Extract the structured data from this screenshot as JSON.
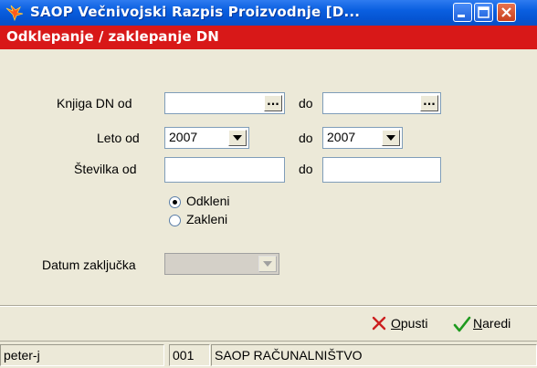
{
  "window": {
    "title": "SAOP   Večnivojski Razpis Proizvodnje [D...",
    "icon": "saop-bird-icon"
  },
  "form_title": "Odklepanje / zaklepanje DN",
  "form": {
    "knjiga_label": "Knjiga DN od",
    "knjiga_od_value": "",
    "do_label": "do",
    "knjiga_do_value": "",
    "ellipsis": "...",
    "leto_label": "Leto od",
    "leto_od_value": "2007",
    "leto_do_value": "2007",
    "stevilka_label": "Številka od",
    "stevilka_od_value": "",
    "stevilka_do_value": "",
    "radio_options": [
      {
        "label": "Odkleni",
        "selected": true
      },
      {
        "label": "Zakleni",
        "selected": false
      }
    ],
    "datum_label": "Datum zaključka",
    "datum_value": ""
  },
  "actions": {
    "cancel_label": "Opusti",
    "ok_label": "Naredi"
  },
  "status": {
    "user": "peter-j",
    "code": "001",
    "company": "SAOP RAČUNALNIŠTVO"
  },
  "colors": {
    "title_blue": "#0554d2",
    "header_red": "#d81818",
    "cancel_red": "#cc1f1f",
    "ok_green": "#1f9a1f"
  }
}
